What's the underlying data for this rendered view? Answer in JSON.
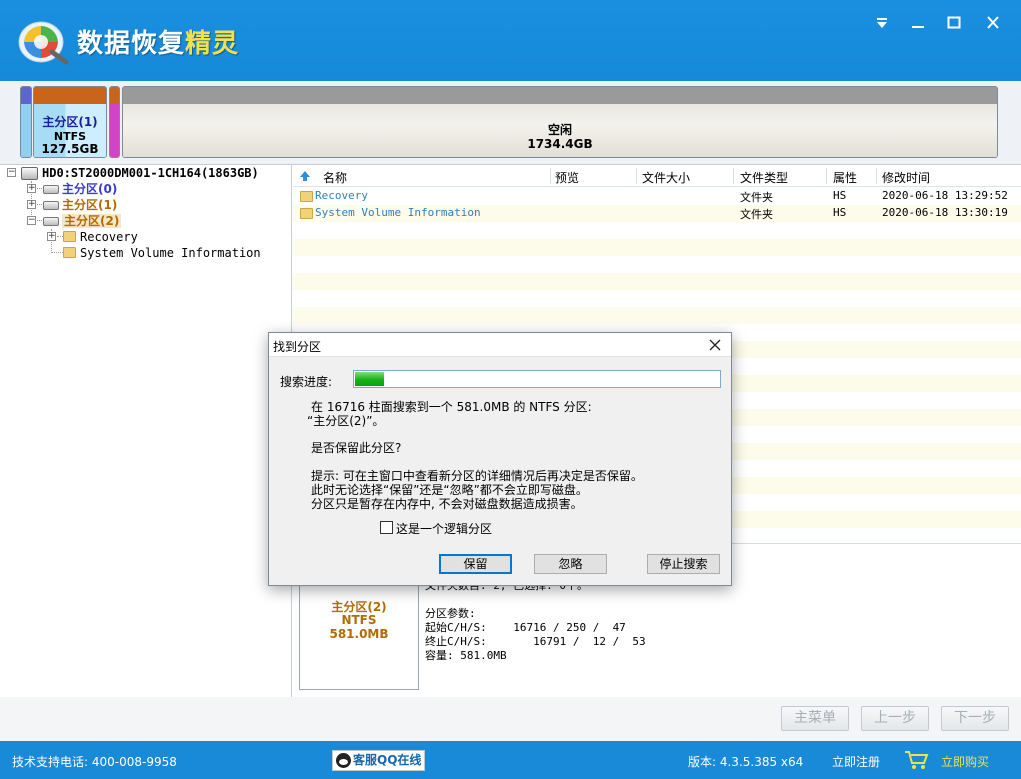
{
  "app": {
    "title_main": "数据恢复",
    "title_accent": "精灵",
    "colors": {
      "header_blue": "#168ad8",
      "title_accent": "#f4e14a",
      "partition_active": "#b36b00",
      "partition_blue": "#3a3ad0"
    }
  },
  "window_controls": {
    "menu_icon": "dropdown-icon",
    "minimize_icon": "minimize-icon",
    "maximize_icon": "maximize-icon",
    "close_icon": "close-icon"
  },
  "partition_bar": {
    "segments": [
      {
        "name": "主分区(1)",
        "fs": "NTFS",
        "size": "127.5GB"
      },
      {
        "name": "空闲",
        "size": "1734.4GB"
      }
    ]
  },
  "tree": {
    "disk": "HD0:ST2000DM001-1CH164(1863GB)",
    "partitions": [
      "主分区(0)",
      "主分区(1)",
      "主分区(2)"
    ],
    "folders": [
      "Recovery",
      "System Volume Information"
    ]
  },
  "file_list": {
    "columns": [
      "名称",
      "预览",
      "文件大小",
      "文件类型",
      "属性",
      "修改时间"
    ],
    "rows": [
      {
        "name": "Recovery",
        "preview": "",
        "size": "",
        "type": "文件夹",
        "attr": "HS",
        "modified": "2020-06-18 13:29:52"
      },
      {
        "name": "System Volume Information",
        "preview": "",
        "size": "",
        "type": "文件夹",
        "attr": "HS",
        "modified": "2020-06-18 13:30:19"
      }
    ]
  },
  "detail": {
    "box": {
      "name": "主分区(2)",
      "fs": "NTFS",
      "size": "581.0MB"
    },
    "file_count": "文件夹数目: 2, 已选择: 0个。",
    "params_label": "分区参数:",
    "start_chs": "起始C/H/S:    16716 / 250 /  47",
    "end_chs": "终止C/H/S:       16791 /  12 /  53",
    "capacity": "容量: 581.0MB"
  },
  "nav": {
    "main_menu": "主菜单",
    "prev": "上一步",
    "next": "下一步"
  },
  "status": {
    "support": "技术支持电话: 400-008-9958",
    "qq": "客服QQ在线",
    "version": "版本: 4.3.5.385 x64",
    "register": "立即注册",
    "buy": "立即购买"
  },
  "dialog": {
    "title": "找到分区",
    "progress_label": "搜索进度:",
    "progress_fraction": 0.08,
    "line1": "在 16716 柱面搜索到一个 581.0MB 的 NTFS 分区:",
    "line2": "“主分区(2)”。",
    "question": "是否保留此分区?",
    "tip1": "提示: 可在主窗口中查看新分区的详细情况后再决定是否保留。",
    "tip2": "此时无论选择“保留”还是“忽略”都不会立即写磁盘。",
    "tip3": "分区只是暂存在内存中, 不会对磁盘数据造成损害。",
    "checkbox_label": "这是一个逻辑分区",
    "buttons": {
      "keep": "保留",
      "ignore": "忽略",
      "stop": "停止搜索"
    }
  }
}
